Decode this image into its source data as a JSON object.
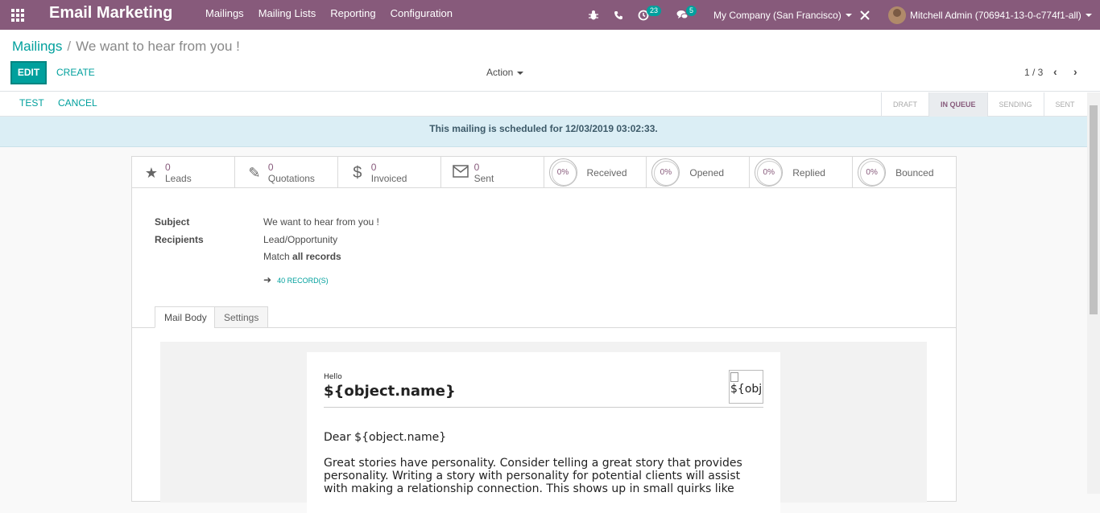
{
  "topbar": {
    "app_title": "Email Marketing",
    "menu": [
      "Mailings",
      "Mailing Lists",
      "Reporting",
      "Configuration"
    ],
    "activity_count": "23",
    "message_count": "5",
    "company": "My Company (San Francisco)",
    "user": "Mitchell Admin (706941-13-0-c774f1-all)"
  },
  "breadcrumb": {
    "parent": "Mailings",
    "separator": "/",
    "current": "We want to hear from you !"
  },
  "buttons": {
    "edit": "EDIT",
    "create": "CREATE",
    "action": "Action",
    "test": "TEST",
    "cancel": "CANCEL"
  },
  "pager": {
    "value": "1 / 3"
  },
  "stages": [
    "DRAFT",
    "IN QUEUE",
    "SENDING",
    "SENT"
  ],
  "active_stage": "IN QUEUE",
  "alert": "This mailing is scheduled for 12/03/2019 03:02:33.",
  "stats": [
    {
      "value": "0",
      "label": "Leads",
      "icon": "star-icon"
    },
    {
      "value": "0",
      "label": "Quotations",
      "icon": "pencil-icon"
    },
    {
      "value": "0",
      "label": "Invoiced",
      "icon": "dollar-icon"
    },
    {
      "value": "0",
      "label": "Sent",
      "icon": "envelope-icon"
    }
  ],
  "gauges": [
    {
      "value": "0%",
      "label": "Received"
    },
    {
      "value": "0%",
      "label": "Opened"
    },
    {
      "value": "0%",
      "label": "Replied"
    },
    {
      "value": "0%",
      "label": "Bounced"
    }
  ],
  "form": {
    "subject_label": "Subject",
    "subject_value": "We want to hear from you !",
    "recipients_label": "Recipients",
    "recipients_value": "Lead/Opportunity",
    "match_prefix": "Match",
    "match_value": "all records",
    "records_button": "40 RECORD(S)"
  },
  "tabs": [
    "Mail Body",
    "Settings"
  ],
  "mail": {
    "hello": "Hello",
    "title": "${object.name}",
    "image_alt": "${obj",
    "dear": "Dear ${object.name}",
    "paragraph": "Great stories have personality. Consider telling a great story that provides personality. Writing a story with personality for potential clients will assist with making a relationship connection. This shows up in small quirks like"
  },
  "colors": {
    "brand": "#875a7b",
    "accent": "#00a09d",
    "alert_bg": "#dbeef5"
  }
}
